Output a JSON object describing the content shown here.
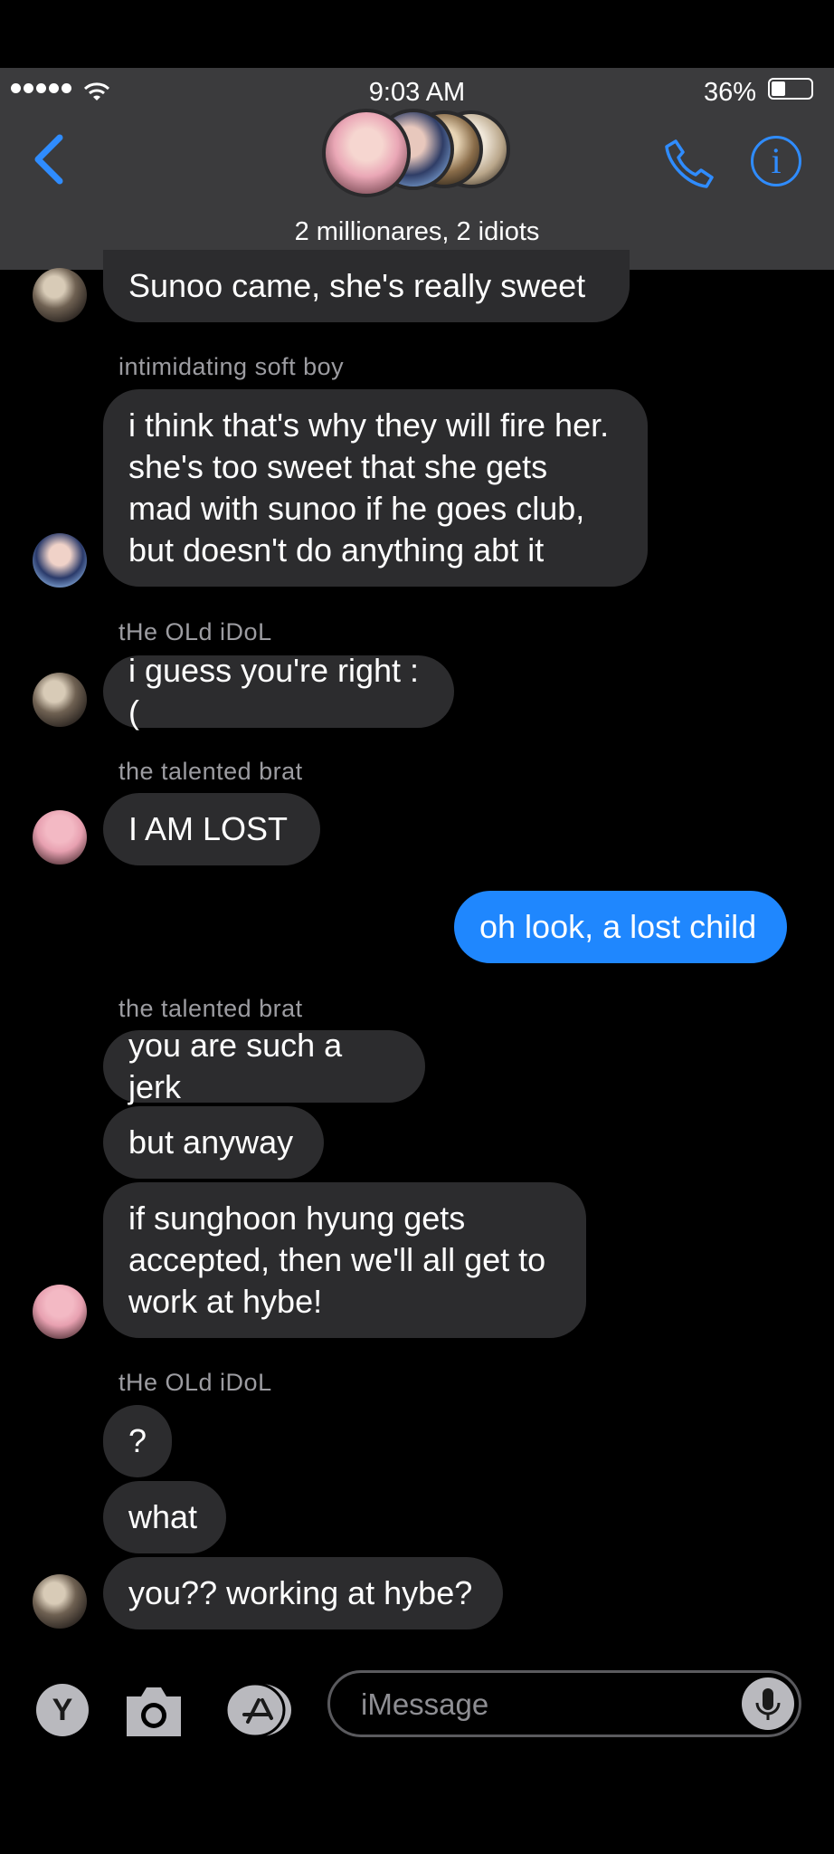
{
  "status_bar": {
    "time": "9:03 AM",
    "battery": "36%",
    "battery_level": 0.36
  },
  "header": {
    "group_name": "2 millionares, 2 idiots"
  },
  "colors": {
    "accent": "#1f87fe",
    "bubble_received": "#2c2c2e",
    "header_bg": "#3b3b3d"
  },
  "icons": {
    "back": "chevron-left-icon",
    "call": "phone-icon",
    "info": "info-icon",
    "info_glyph": "i",
    "apps": "app-store-icon",
    "camera": "camera-icon",
    "mic": "microphone-icon",
    "app_y_letter": "Y"
  },
  "messages": [
    {
      "text": "Sunoo came, she's really sweet"
    },
    {
      "sender": "intimidating soft boy",
      "text": "i think that's why they will fire her.\nshe's too sweet that she gets\nmad with sunoo if he goes club,\nbut doesn't do anything abt it"
    },
    {
      "sender": "tHe OLd iDoL",
      "text": "i guess you're right :("
    },
    {
      "sender": "the talented brat",
      "text": "I AM LOST"
    },
    {
      "text": "oh look, a lost child"
    },
    {
      "sender": "the talented brat",
      "text": "you are such a jerk"
    },
    {
      "text": "but anyway"
    },
    {
      "text": "if sunghoon hyung gets\naccepted, then we'll all get to\nwork at hybe!"
    },
    {
      "sender": "tHe OLd iDoL",
      "text": "?"
    },
    {
      "text": "what"
    },
    {
      "text": "you?? working at hybe?"
    }
  ],
  "composer": {
    "placeholder": "iMessage"
  }
}
